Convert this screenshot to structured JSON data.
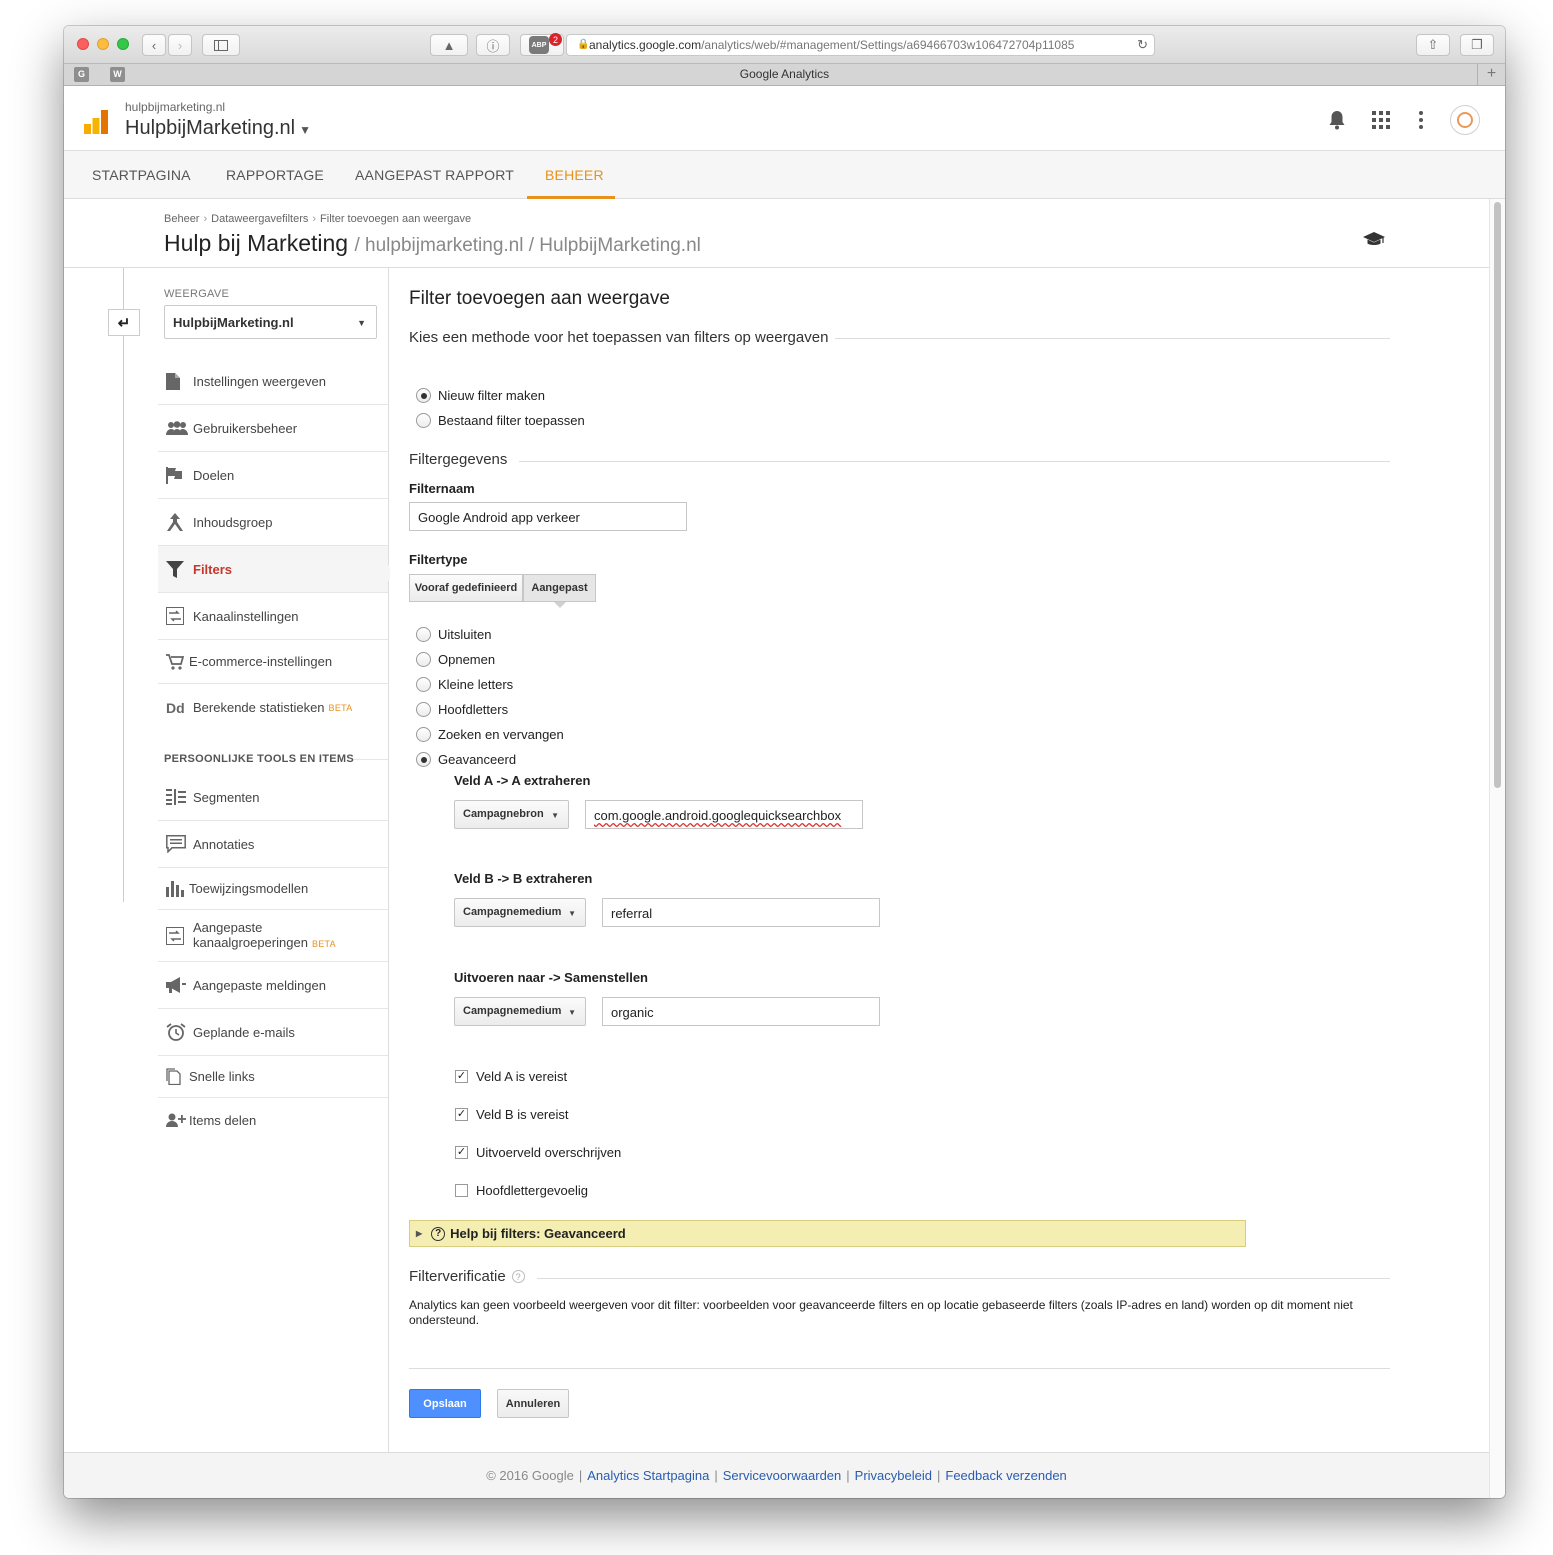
{
  "browser": {
    "url_host": "analytics.google.com",
    "url_path": "/analytics/web/#management/Settings/a69466703w106472704p11085",
    "tab_title": "Google Analytics",
    "abp_label": "ABP",
    "abp_count": "2",
    "favicons": [
      "G",
      "W"
    ]
  },
  "header": {
    "account_small": "hulpbijmarketing.nl",
    "account_big": "HulpbijMarketing.nl"
  },
  "nav": {
    "tabs": [
      "STARTPAGINA",
      "RAPPORTAGE",
      "AANGEPAST RAPPORT",
      "BEHEER"
    ],
    "active": "BEHEER"
  },
  "page": {
    "breadcrumbs": [
      "Beheer",
      "Dataweergavefilters",
      "Filter toevoegen aan weergave"
    ],
    "title": "Hulp bij Marketing",
    "title_sub": "/ hulpbijmarketing.nl / HulpbijMarketing.nl"
  },
  "sidebar": {
    "view_label": "WEERGAVE",
    "view_value": "HulpbijMarketing.nl",
    "items": [
      {
        "label": "Instellingen weergeven",
        "icon": "document-icon"
      },
      {
        "label": "Gebruikersbeheer",
        "icon": "users-icon"
      },
      {
        "label": "Doelen",
        "icon": "flag-icon"
      },
      {
        "label": "Inhoudsgroep",
        "icon": "content-group-icon"
      },
      {
        "label": "Filters",
        "icon": "filter-icon"
      },
      {
        "label": "Kanaalinstellingen",
        "icon": "channel-icon"
      },
      {
        "label": "E-commerce-instellingen",
        "icon": "cart-icon"
      },
      {
        "label": "Berekende statistieken",
        "icon": "dd-icon",
        "badge": "BETA"
      }
    ],
    "section_title": "PERSOONLIJKE TOOLS EN ITEMS",
    "tools": [
      {
        "label": "Segmenten",
        "icon": "segments-icon"
      },
      {
        "label": "Annotaties",
        "icon": "annotation-icon"
      },
      {
        "label": "Toewijzingsmodellen",
        "icon": "bar-chart-icon"
      },
      {
        "label_line1": "Aangepaste",
        "label_line2": "kanaalgroeperingen",
        "icon": "channel-icon",
        "badge": "BETA"
      },
      {
        "label": "Aangepaste meldingen",
        "icon": "megaphone-icon"
      },
      {
        "label": "Geplande e-mails",
        "icon": "alarm-icon"
      },
      {
        "label": "Snelle links",
        "icon": "copy-icon"
      },
      {
        "label": "Items delen",
        "icon": "add-user-icon"
      }
    ]
  },
  "form": {
    "title": "Filter toevoegen aan weergave",
    "method_legend": "Kies een methode voor het toepassen van filters op weergaven",
    "method_options": [
      "Nieuw filter maken",
      "Bestaand filter toepassen"
    ],
    "method_selected": "Nieuw filter maken",
    "details_legend": "Filtergegevens",
    "name_label": "Filternaam",
    "name_value": "Google Android app verkeer",
    "type_label": "Filtertype",
    "type_buttons": [
      "Vooraf gedefinieerd",
      "Aangepast"
    ],
    "type_selected": "Aangepast",
    "custom_options": [
      "Uitsluiten",
      "Opnemen",
      "Kleine letters",
      "Hoofdletters",
      "Zoeken en vervangen",
      "Geavanceerd"
    ],
    "custom_selected": "Geavanceerd",
    "field_a": {
      "label": "Veld A -> A extraheren",
      "select": "Campagnebron",
      "value": "com.google.android.googlequicksearchbox"
    },
    "field_b": {
      "label": "Veld B -> B extraheren",
      "select": "Campagnemedium",
      "value": "referral"
    },
    "output": {
      "label": "Uitvoeren naar -> Samenstellen",
      "select": "Campagnemedium",
      "value": "organic"
    },
    "checks": [
      {
        "label": "Veld A is vereist",
        "checked": true
      },
      {
        "label": "Veld B is vereist",
        "checked": true
      },
      {
        "label": "Uitvoerveld overschrijven",
        "checked": true
      },
      {
        "label": "Hoofdlettergevoelig",
        "checked": false
      }
    ],
    "help_label": "Help bij filters: Geavanceerd",
    "verify_legend": "Filterverificatie",
    "verify_text": "Analytics kan geen voorbeeld weergeven voor dit filter: voorbeelden voor geavanceerde filters en op locatie gebaseerde filters (zoals IP-adres en land) worden op dit moment niet ondersteund.",
    "save_label": "Opslaan",
    "cancel_label": "Annuleren"
  },
  "footer": {
    "copyright": "© 2016 Google",
    "links": [
      "Analytics Startpagina",
      "Servicevoorwaarden",
      "Privacybeleid",
      "Feedback verzenden"
    ]
  },
  "colors": {
    "accent_orange": "#e8911c",
    "active_red": "#c5382a",
    "save_blue": "#4d90fe",
    "help_yellow": "#f5eeb2",
    "link_blue": "#2a5db0"
  }
}
